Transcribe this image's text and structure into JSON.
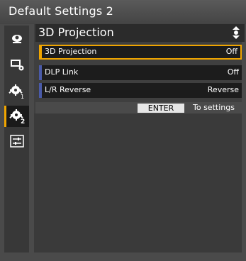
{
  "window": {
    "title": "Default Settings 2"
  },
  "sidebar": {
    "items": [
      {
        "icon": "projector-icon",
        "active": false
      },
      {
        "icon": "display-settings-icon",
        "active": false
      },
      {
        "icon": "settings-1-icon",
        "active": false
      },
      {
        "icon": "settings-2-icon",
        "active": true
      },
      {
        "icon": "adjust-sliders-icon",
        "active": false
      }
    ]
  },
  "panel": {
    "title": "3D Projection",
    "nav_icon": "up-down-icon"
  },
  "menu": {
    "rows": [
      {
        "label": "3D Projection",
        "value": "Off",
        "selected": true
      },
      {
        "label": "DLP Link",
        "value": "Off",
        "selected": false
      },
      {
        "label": "L/R Reverse",
        "value": "Reverse",
        "selected": false
      }
    ]
  },
  "footer": {
    "key_label": "ENTER",
    "hint": "To settings"
  },
  "colors": {
    "accent": "#f0a500",
    "row_marker": "#4a5aa8",
    "background": "#4a4a4a"
  }
}
